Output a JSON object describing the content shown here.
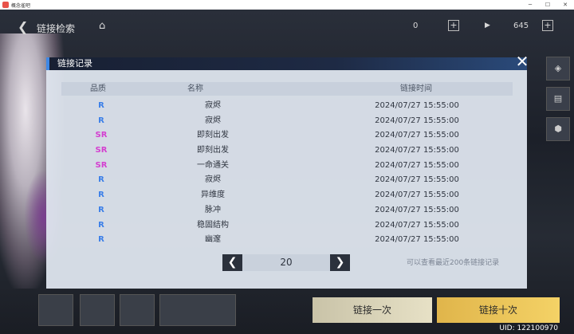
{
  "window": {
    "title": "概念雀吧"
  },
  "game": {
    "nav_title": "链接检索",
    "resources": [
      {
        "value": "0"
      },
      {
        "value": "645"
      }
    ],
    "pull_one_label": "链接一次",
    "pull_ten_label": "链接十次",
    "uid": "UID:  122100970"
  },
  "dialog": {
    "title": "链接记录",
    "columns": {
      "quality": "品质",
      "name": "名称",
      "time": "链接时间"
    },
    "rows": [
      {
        "quality": "R",
        "name": "寂烬",
        "time": "2024/07/27 15:55:00"
      },
      {
        "quality": "R",
        "name": "寂烬",
        "time": "2024/07/27 15:55:00"
      },
      {
        "quality": "SR",
        "name": "即刻出发",
        "time": "2024/07/27 15:55:00"
      },
      {
        "quality": "SR",
        "name": "即刻出发",
        "time": "2024/07/27 15:55:00"
      },
      {
        "quality": "SR",
        "name": "一命通关",
        "time": "2024/07/27 15:55:00"
      },
      {
        "quality": "R",
        "name": "寂烬",
        "time": "2024/07/27 15:55:00"
      },
      {
        "quality": "R",
        "name": "异维度",
        "time": "2024/07/27 15:55:00"
      },
      {
        "quality": "R",
        "name": "脉冲",
        "time": "2024/07/27 15:55:00"
      },
      {
        "quality": "R",
        "name": "稳固结构",
        "time": "2024/07/27 15:55:00"
      },
      {
        "quality": "R",
        "name": "幽邃",
        "time": "2024/07/27 15:55:00"
      }
    ],
    "page": "20",
    "hint": "可以查看最近200条链接记录",
    "colors": {
      "R": "#3a7ee8",
      "SR": "#d43fd0"
    }
  }
}
